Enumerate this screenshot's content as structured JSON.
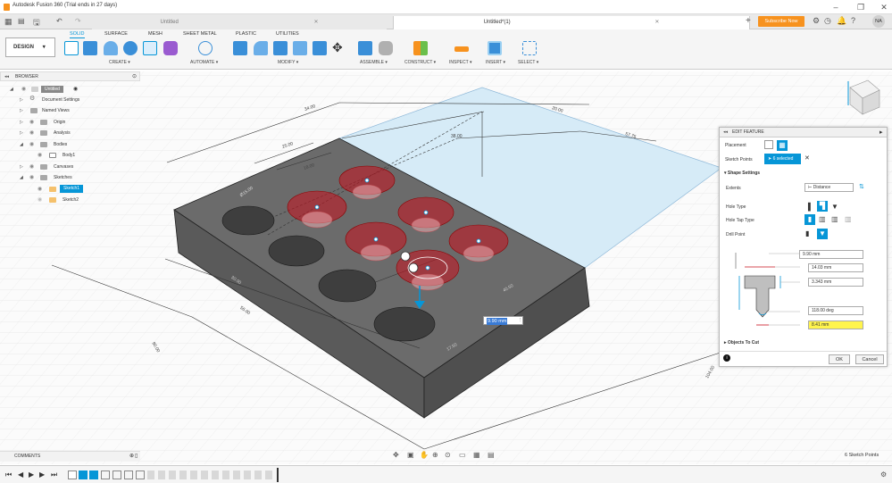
{
  "window": {
    "title": "Autodesk Fusion 360 (Trial ends in 27 days)",
    "user_initials": "NA"
  },
  "tabs": [
    {
      "label": "Untitled"
    },
    {
      "label": "Untitled*(1)"
    }
  ],
  "subscribe_label": "Subscribe Now",
  "workspace": {
    "label": "DESIGN"
  },
  "ribbon": {
    "tabs": [
      {
        "label": "SOLID",
        "active": true
      },
      {
        "label": "SURFACE"
      },
      {
        "label": "MESH"
      },
      {
        "label": "SHEET METAL"
      },
      {
        "label": "PLASTIC"
      },
      {
        "label": "UTILITIES"
      }
    ],
    "groups": [
      {
        "label": "CREATE ▾"
      },
      {
        "label": "AUTOMATE ▾"
      },
      {
        "label": "MODIFY ▾"
      },
      {
        "label": "ASSEMBLE ▾"
      },
      {
        "label": "CONSTRUCT ▾"
      },
      {
        "label": "INSPECT ▾"
      },
      {
        "label": "INSERT ▾"
      },
      {
        "label": "SELECT ▾"
      }
    ]
  },
  "browser": {
    "title": "BROWSER",
    "items": [
      {
        "label": "Untitled",
        "icon": "document-icon"
      },
      {
        "label": "Document Settings",
        "icon": "gear-icon"
      },
      {
        "label": "Named Views",
        "icon": "folder-icon"
      },
      {
        "label": "Origin",
        "icon": "folder-icon"
      },
      {
        "label": "Analysis",
        "icon": "folder-icon"
      },
      {
        "label": "Bodies",
        "icon": "folder-icon"
      },
      {
        "label": "Body1",
        "icon": "body-icon"
      },
      {
        "label": "Canvases",
        "icon": "folder-icon"
      },
      {
        "label": "Sketches",
        "icon": "folder-icon"
      },
      {
        "label": "Sketch1",
        "icon": "sketch-icon",
        "selected": true
      },
      {
        "label": "Sketch2",
        "icon": "sketch-icon"
      }
    ]
  },
  "edit_feature": {
    "title": "EDIT FEATURE",
    "placement_label": "Placement",
    "sketch_points_label": "Sketch Points",
    "sketch_points_value": "6 selected",
    "shape_settings_label": "Shape Settings",
    "extents_label": "Extents",
    "extents_value": "Distance",
    "hole_type_label": "Hole Type",
    "hole_tap_type_label": "Hole Tap Type",
    "drill_point_label": "Drill Point",
    "dims": [
      "9.90 mm",
      "14.03 mm",
      "3.343 mm",
      "118.00 deg",
      "8.41 mm"
    ],
    "objects_to_cut_label": "Objects To Cut",
    "ok_label": "OK",
    "cancel_label": "Cancel"
  },
  "viewport": {
    "dim_input": "9.90 mm",
    "dim_labels": [
      "34.00",
      "20.00",
      "57.75",
      "38.00",
      "25.00",
      "18.00",
      "Ø15.00",
      "40.50",
      "56.00",
      "30.00",
      "17.50",
      "90.00",
      "104.00"
    ]
  },
  "comments_label": "COMMENTS",
  "status_text": "6 Sketch Points",
  "colors": {
    "accent": "#0696d7",
    "subscribe": "#f7921e",
    "hole_red": "#c8101e",
    "body": "#6b6b6b",
    "sketch_blue": "#d6ebf7",
    "highlight": "#fff44d"
  }
}
